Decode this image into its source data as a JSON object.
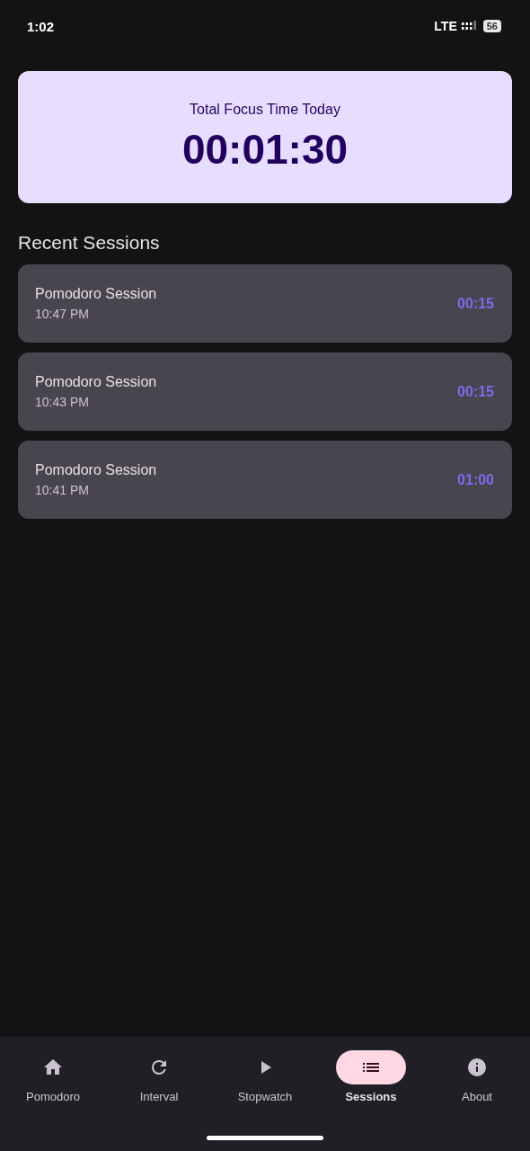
{
  "status_bar": {
    "time": "1:02",
    "network": "LTE",
    "battery": "56"
  },
  "summary": {
    "label": "Total Focus Time Today",
    "value": "00:01:30"
  },
  "recent": {
    "title": "Recent Sessions",
    "sessions": [
      {
        "name": "Pomodoro Session",
        "time": "10:47 PM",
        "duration": "00:15"
      },
      {
        "name": "Pomodoro Session",
        "time": "10:43 PM",
        "duration": "00:15"
      },
      {
        "name": "Pomodoro Session",
        "time": "10:41 PM",
        "duration": "01:00"
      }
    ]
  },
  "nav": [
    {
      "label": "Pomodoro",
      "kind": "home",
      "selected": false
    },
    {
      "label": "Interval",
      "kind": "refresh",
      "selected": false
    },
    {
      "label": "Stopwatch",
      "kind": "play",
      "selected": false
    },
    {
      "label": "Sessions",
      "kind": "list",
      "selected": true
    },
    {
      "label": "About",
      "kind": "info",
      "selected": false
    }
  ]
}
